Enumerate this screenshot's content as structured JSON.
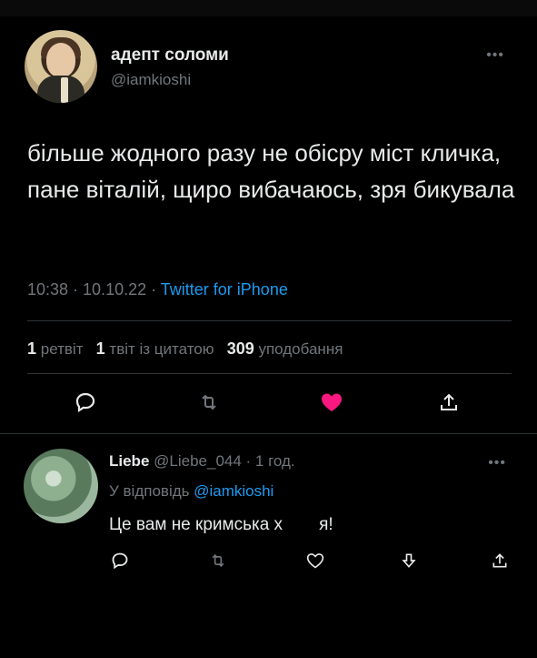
{
  "tweet": {
    "display_name": "адепт соломи",
    "handle": "@iamkioshi",
    "text": "більше жодного разу не обісру міст кличка, пане віталій, щиро вибачаюсь, зря бикувала",
    "time": "10:38 · 10.10.22 · ",
    "source": "Twitter for iPhone",
    "stats": {
      "retweets_count": "1",
      "retweets_label": "ретвіт",
      "quotes_count": "1",
      "quotes_label": "твіт із цитатою",
      "likes_count": "309",
      "likes_label": "уподобання"
    },
    "liked": true,
    "colors": {
      "like": "#f91880",
      "link": "#1d9bf0",
      "muted": "#71767b"
    }
  },
  "reply": {
    "display_name": "Liebe",
    "handle_time": "@Liebe_044 · 1 год.",
    "reply_prefix": "У відповідь ",
    "reply_mention": "@iamkioshi",
    "text_start": "Це вам не кримська х",
    "text_end": "я!"
  },
  "icons": {
    "more": "more-icon",
    "reply": "reply-icon",
    "retweet": "retweet-icon",
    "like": "heart-icon",
    "share": "share-icon",
    "downvote": "downvote-icon"
  }
}
